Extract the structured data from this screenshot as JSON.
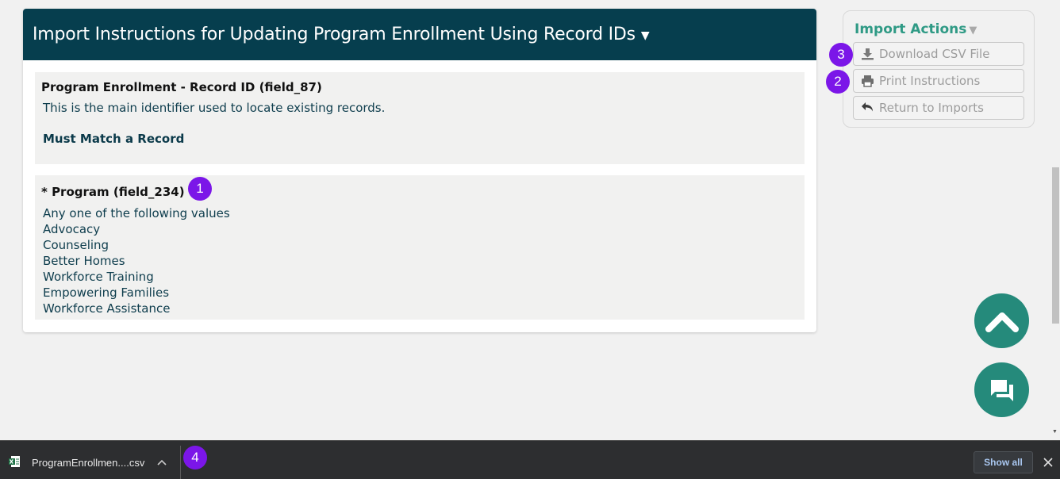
{
  "header": {
    "title": "Import Instructions for Updating Program Enrollment Using Record IDs",
    "caret_icon": "caret-down-icon"
  },
  "fields": [
    {
      "title": "Program Enrollment - Record ID (field_87)",
      "description": "This is the main identifier used to locate existing records.",
      "rule": "Must Match a Record"
    },
    {
      "title": "* Program (field_234)",
      "values_intro": "Any one of the following values",
      "values": [
        "Advocacy",
        "Counseling",
        "Better Homes",
        "Workforce Training",
        "Empowering Families",
        "Workforce Assistance"
      ]
    }
  ],
  "import_actions": {
    "title": "Import Actions",
    "buttons": [
      {
        "label": "Download CSV File",
        "icon": "download-icon"
      },
      {
        "label": "Print Instructions",
        "icon": "printer-icon"
      },
      {
        "label": "Return to Imports",
        "icon": "undo-icon"
      }
    ]
  },
  "badges": [
    "1",
    "2",
    "3",
    "4"
  ],
  "download_bar": {
    "file_name": "ProgramEnrollmen....csv",
    "show_all": "Show all"
  },
  "colors": {
    "header_bg": "#063e4e",
    "accent": "#2f9a85",
    "badge": "#7b16e8",
    "fab": "#258a7b"
  }
}
